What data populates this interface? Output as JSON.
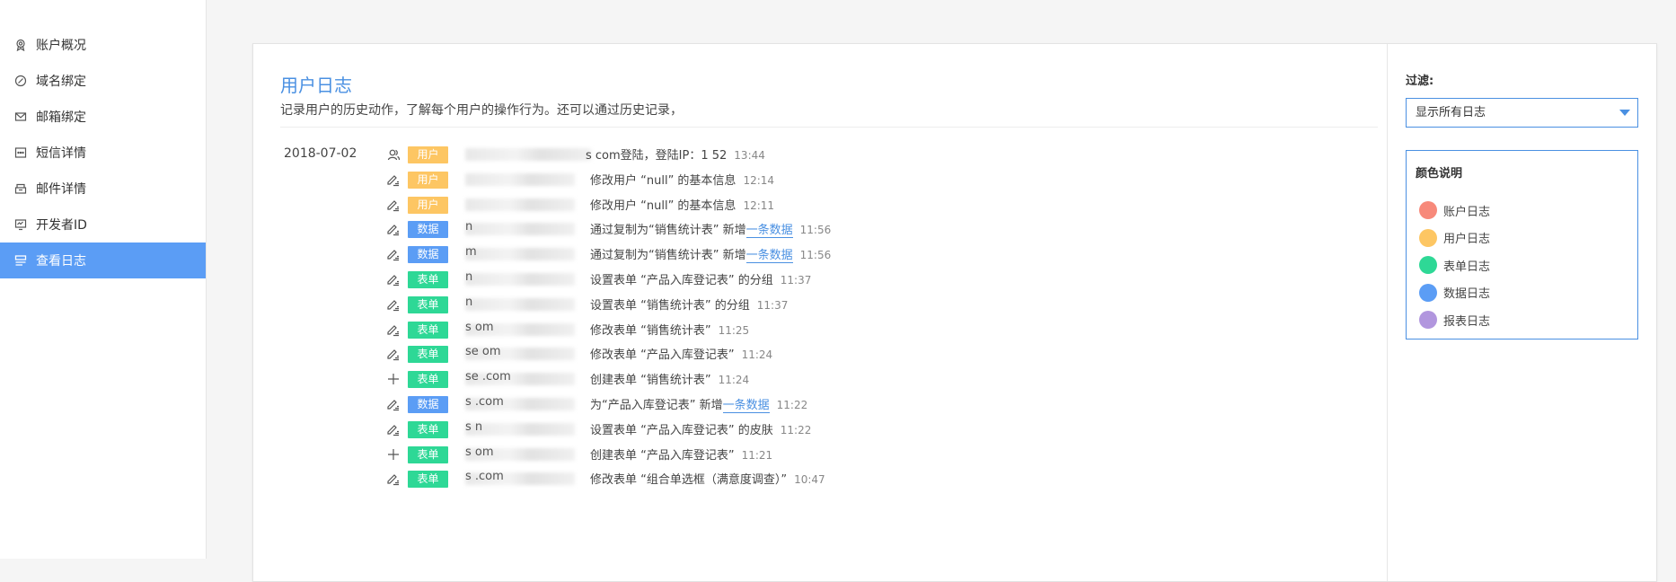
{
  "colors": {
    "account": "#f7897a",
    "user": "#fdc663",
    "form": "#2ed896",
    "data": "#5b9df5",
    "report": "#b196de",
    "accent": "#4a90e2"
  },
  "sidebar": {
    "items": [
      {
        "label": "账户概况",
        "icon": "badge-icon"
      },
      {
        "label": "域名绑定",
        "icon": "link-icon"
      },
      {
        "label": "邮箱绑定",
        "icon": "mail-icon"
      },
      {
        "label": "短信详情",
        "icon": "sms-icon"
      },
      {
        "label": "邮件详情",
        "icon": "inbox-icon"
      },
      {
        "label": "开发者ID",
        "icon": "developer-icon"
      },
      {
        "label": "查看日志",
        "icon": "log-icon",
        "active": true
      }
    ]
  },
  "main": {
    "title": "用户日志",
    "description": "记录用户的历史动作，了解每个用户的操作行为。还可以通过历史记录，",
    "date": "2018-07-02",
    "rows": [
      {
        "icon": "users-icon",
        "tag": "用户",
        "tagType": "user",
        "user": "",
        "action": "s                  com登陆，登陆IP：1          52",
        "link": "",
        "after": "",
        "time": "13:44"
      },
      {
        "icon": "edit-icon",
        "tag": "用户",
        "tagType": "user",
        "user": "",
        "action": "修改用户 “null” 的基本信息",
        "link": "",
        "after": "",
        "time": "12:14"
      },
      {
        "icon": "edit-icon",
        "tag": "用户",
        "tagType": "user",
        "user": "",
        "action": "修改用户 “null” 的基本信息",
        "link": "",
        "after": "",
        "time": "12:11"
      },
      {
        "icon": "edit-icon",
        "tag": "数据",
        "tagType": "data",
        "user": "n",
        "action": "通过复制为“销售统计表” 新增",
        "link": "一条数据",
        "after": "",
        "time": "11:56"
      },
      {
        "icon": "edit-icon",
        "tag": "数据",
        "tagType": "data",
        "user": "m",
        "action": "通过复制为“销售统计表” 新增",
        "link": "一条数据",
        "after": "",
        "time": "11:56"
      },
      {
        "icon": "edit-icon",
        "tag": "表单",
        "tagType": "form",
        "user": "n",
        "action": "设置表单 “产品入库登记表” 的分组",
        "link": "",
        "after": "",
        "time": "11:37"
      },
      {
        "icon": "edit-icon",
        "tag": "表单",
        "tagType": "form",
        "user": "n",
        "action": "设置表单 “销售统计表” 的分组",
        "link": "",
        "after": "",
        "time": "11:37"
      },
      {
        "icon": "edit-icon",
        "tag": "表单",
        "tagType": "form",
        "user": "s                 om",
        "action": "修改表单 “销售统计表”",
        "link": "",
        "after": "",
        "time": "11:25"
      },
      {
        "icon": "edit-icon",
        "tag": "表单",
        "tagType": "form",
        "user": "se               om",
        "action": "修改表单 “产品入库登记表”",
        "link": "",
        "after": "",
        "time": "11:24"
      },
      {
        "icon": "plus-icon",
        "tag": "表单",
        "tagType": "form",
        "user": "se               .com",
        "action": "创建表单 “销售统计表”",
        "link": "",
        "after": "",
        "time": "11:24"
      },
      {
        "icon": "edit-icon",
        "tag": "数据",
        "tagType": "data",
        "user": "s                .com",
        "action": "为“产品入库登记表” 新增",
        "link": "一条数据",
        "after": "",
        "time": "11:22"
      },
      {
        "icon": "edit-icon",
        "tag": "表单",
        "tagType": "form",
        "user": "s                 n",
        "action": "设置表单 “产品入库登记表” 的皮肤",
        "link": "",
        "after": "",
        "time": "11:22"
      },
      {
        "icon": "plus-icon",
        "tag": "表单",
        "tagType": "form",
        "user": "s                 om",
        "action": "创建表单 “产品入库登记表”",
        "link": "",
        "after": "",
        "time": "11:21"
      },
      {
        "icon": "edit-icon",
        "tag": "表单",
        "tagType": "form",
        "user": "s              .com",
        "action": "修改表单 “组合单选框（满意度调查）”",
        "link": "",
        "after": "",
        "time": "10:47"
      }
    ]
  },
  "side": {
    "filter_label": "过滤:",
    "select_value": "显示所有日志",
    "legend_title": "颜色说明",
    "legend": [
      {
        "label": "账户日志",
        "type": "account"
      },
      {
        "label": "用户日志",
        "type": "user"
      },
      {
        "label": "表单日志",
        "type": "form"
      },
      {
        "label": "数据日志",
        "type": "data"
      },
      {
        "label": "报表日志",
        "type": "report"
      }
    ]
  }
}
